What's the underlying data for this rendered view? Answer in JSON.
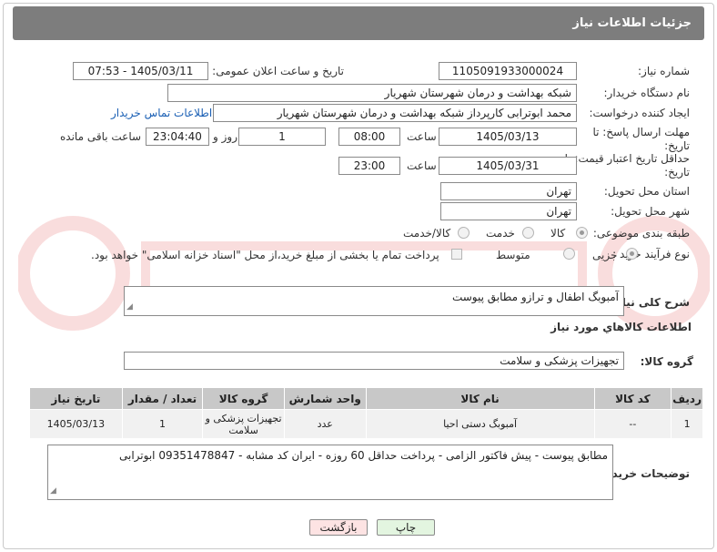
{
  "header": {
    "title": "جزئیات اطلاعات نیاز"
  },
  "fields": {
    "need_number": {
      "label": "شماره نیاز:",
      "value": "1105091933000024"
    },
    "announce_datetime": {
      "label": "تاریخ و ساعت اعلان عمومی:",
      "value": "1405/03/11 - 07:53"
    },
    "buyer_org": {
      "label": "نام دستگاه خریدار:",
      "value": "شبکه بهداشت و درمان شهرستان شهریار"
    },
    "requester": {
      "label": "ایجاد کننده درخواست:",
      "value": "محمد ابوترابی کارپرداز شبکه بهداشت و درمان شهرستان شهریار",
      "contact_link": "اطلاعات تماس خریدار"
    },
    "reply_deadline": {
      "label": "مهلت ارسال پاسخ: تا تاریخ:",
      "date": "1405/03/13",
      "time_label": "ساعت",
      "time": "08:00",
      "days": "1",
      "days_label": "روز و",
      "remaining": "23:04:40",
      "remaining_label": "ساعت باقی مانده"
    },
    "price_validity": {
      "label": "حداقل تاریخ اعتبار قیمت: تا تاریخ:",
      "date": "1405/03/31",
      "time_label": "ساعت",
      "time": "23:00"
    },
    "delivery_province": {
      "label": "استان محل تحویل:",
      "value": "تهران"
    },
    "delivery_city": {
      "label": "شهر محل تحویل:",
      "value": "تهران"
    },
    "category": {
      "label": "طبقه بندی موضوعی:",
      "options": [
        "کالا",
        "خدمت",
        "کالا/خدمت"
      ],
      "selected": "کالا"
    },
    "purchase_process": {
      "label": "نوع فرآیند خرید :",
      "options": [
        "جزیی",
        "متوسط"
      ],
      "selected": "جزیی",
      "payment_note": "پرداخت تمام یا بخشی از مبلغ خرید،از محل \"اسناد خزانه اسلامی\" خواهد بود."
    }
  },
  "description": {
    "label": "شرح کلی نیاز:",
    "value": "آمبوبگ اطفال و ترازو مطابق پیوست"
  },
  "goods_section": {
    "title": "اطلاعات کالاهاي مورد نياز",
    "group_label": "گروه کالا:",
    "group_value": "تجهیزات پزشکی و سلامت",
    "columns": [
      "ردیف",
      "کد کالا",
      "نام کالا",
      "واحد شمارش",
      "گروه کالا",
      "تعداد / مقدار",
      "تاریخ نیاز"
    ],
    "rows": [
      {
        "row": "1",
        "code": "--",
        "name": "آمبوبگ دستی احیا",
        "unit": "عدد",
        "group": "تجهیزات پزشکی و سلامت",
        "qty": "1",
        "date": "1405/03/13"
      }
    ]
  },
  "buyer_notes": {
    "label": "توضیحات خریدار:",
    "value": "مطابق پیوست - پیش فاکتور الزامی - پرداخت حداقل 60 روزه - ایران کد مشابه - 09351478847 ابوترابی"
  },
  "buttons": {
    "print": "چاپ",
    "back": "بازگشت"
  },
  "colors": {
    "header_bg": "#7d7d7d",
    "table_header_bg": "#c8c8c8",
    "print_btn_bg": "#e3f5e0",
    "back_btn_bg": "#fde3e3",
    "link": "#1a5fb4"
  }
}
